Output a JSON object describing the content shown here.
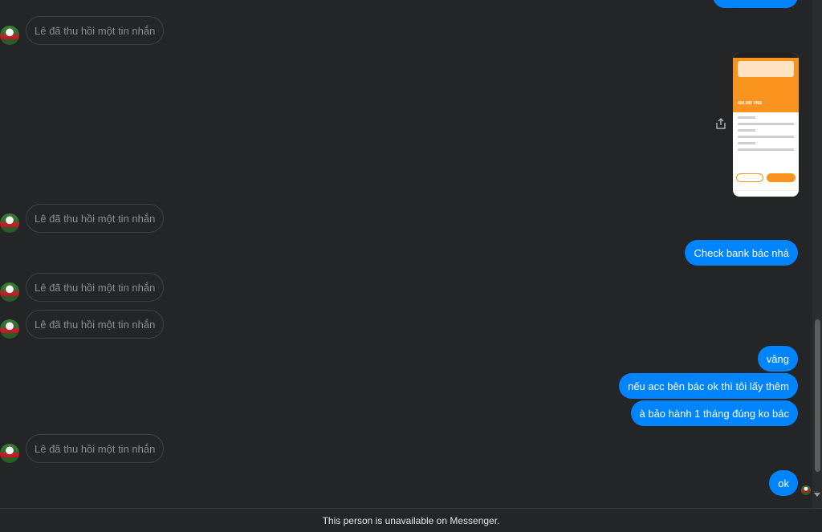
{
  "messages": {
    "recalled_text": "Lê đã thu hồi một tin nhắn",
    "outgoing": [
      "Check bank bác nhá",
      "vâng",
      "nếu acc bên bác ok thì tôi lấy thêm",
      "à bảo hành 1 tháng đúng ko bác",
      "ok"
    ],
    "attachment": {
      "kind": "screenshot-image",
      "amount": "400.000 VNĐ"
    }
  },
  "footer": {
    "notice": "This person is unavailable on Messenger."
  },
  "icons": {
    "share": "share-icon",
    "avatar": "avatar",
    "seen": "seen-avatar-icon"
  },
  "colors": {
    "background": "#242526",
    "outgoing_bubble": "#0084ff",
    "recalled_border": "#3e4042",
    "recalled_text": "#8a8d91"
  }
}
